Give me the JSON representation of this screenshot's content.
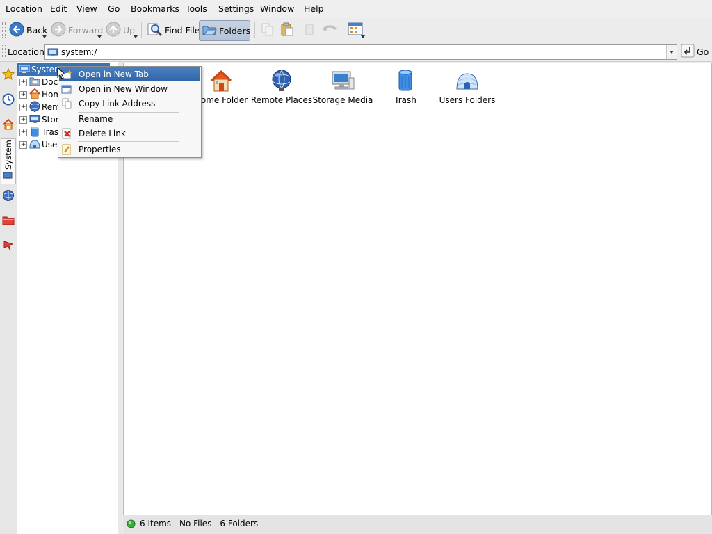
{
  "menubar": {
    "items": [
      {
        "prefix": "",
        "accel": "L",
        "rest": "ocation"
      },
      {
        "prefix": "",
        "accel": "E",
        "rest": "dit"
      },
      {
        "prefix": "",
        "accel": "V",
        "rest": "iew"
      },
      {
        "prefix": "",
        "accel": "G",
        "rest": "o"
      },
      {
        "prefix": "",
        "accel": "B",
        "rest": "ookmarks"
      },
      {
        "prefix": "",
        "accel": "T",
        "rest": "ools"
      },
      {
        "prefix": "",
        "accel": "S",
        "rest": "ettings"
      },
      {
        "prefix": "",
        "accel": "W",
        "rest": "indow"
      },
      {
        "prefix": "",
        "accel": "H",
        "rest": "elp"
      }
    ]
  },
  "toolbar": {
    "back": "Back",
    "forward": "Forward",
    "up": "Up",
    "find_file": "Find File",
    "folders": "Folders"
  },
  "location": {
    "label_accel": "L",
    "label_rest": "ocation:",
    "value": "system:/",
    "go": "Go"
  },
  "sidebar": {
    "tab_system": "System",
    "tab_icons": [
      "bookmark-star-icon",
      "history-clock-icon",
      "home-icon",
      "storage-icon",
      "network-globe-icon",
      "folder-icon",
      "services-icon"
    ]
  },
  "tree": {
    "root": "System",
    "items": [
      "Docu",
      "Hom",
      "Rem",
      "Stora",
      "Trasl",
      "User"
    ]
  },
  "view": {
    "items": [
      {
        "label": "Home Folder",
        "icon": "home-icon"
      },
      {
        "label": "Remote Places",
        "icon": "globe-icon"
      },
      {
        "label": "Storage Media",
        "icon": "computer-icon"
      },
      {
        "label": "Trash",
        "icon": "trash-icon"
      },
      {
        "label": "Users Folders",
        "icon": "users-folder-icon"
      }
    ]
  },
  "status": {
    "text": "6 Items - No Files - 6 Folders"
  },
  "context_menu": {
    "items": [
      "Open in New Tab",
      "Open in New Window",
      "Copy Link Address",
      "Rename",
      "Delete Link",
      "Properties"
    ]
  },
  "colors": {
    "highlight": "#3a72b4",
    "status_ok": "#3fae3f"
  }
}
